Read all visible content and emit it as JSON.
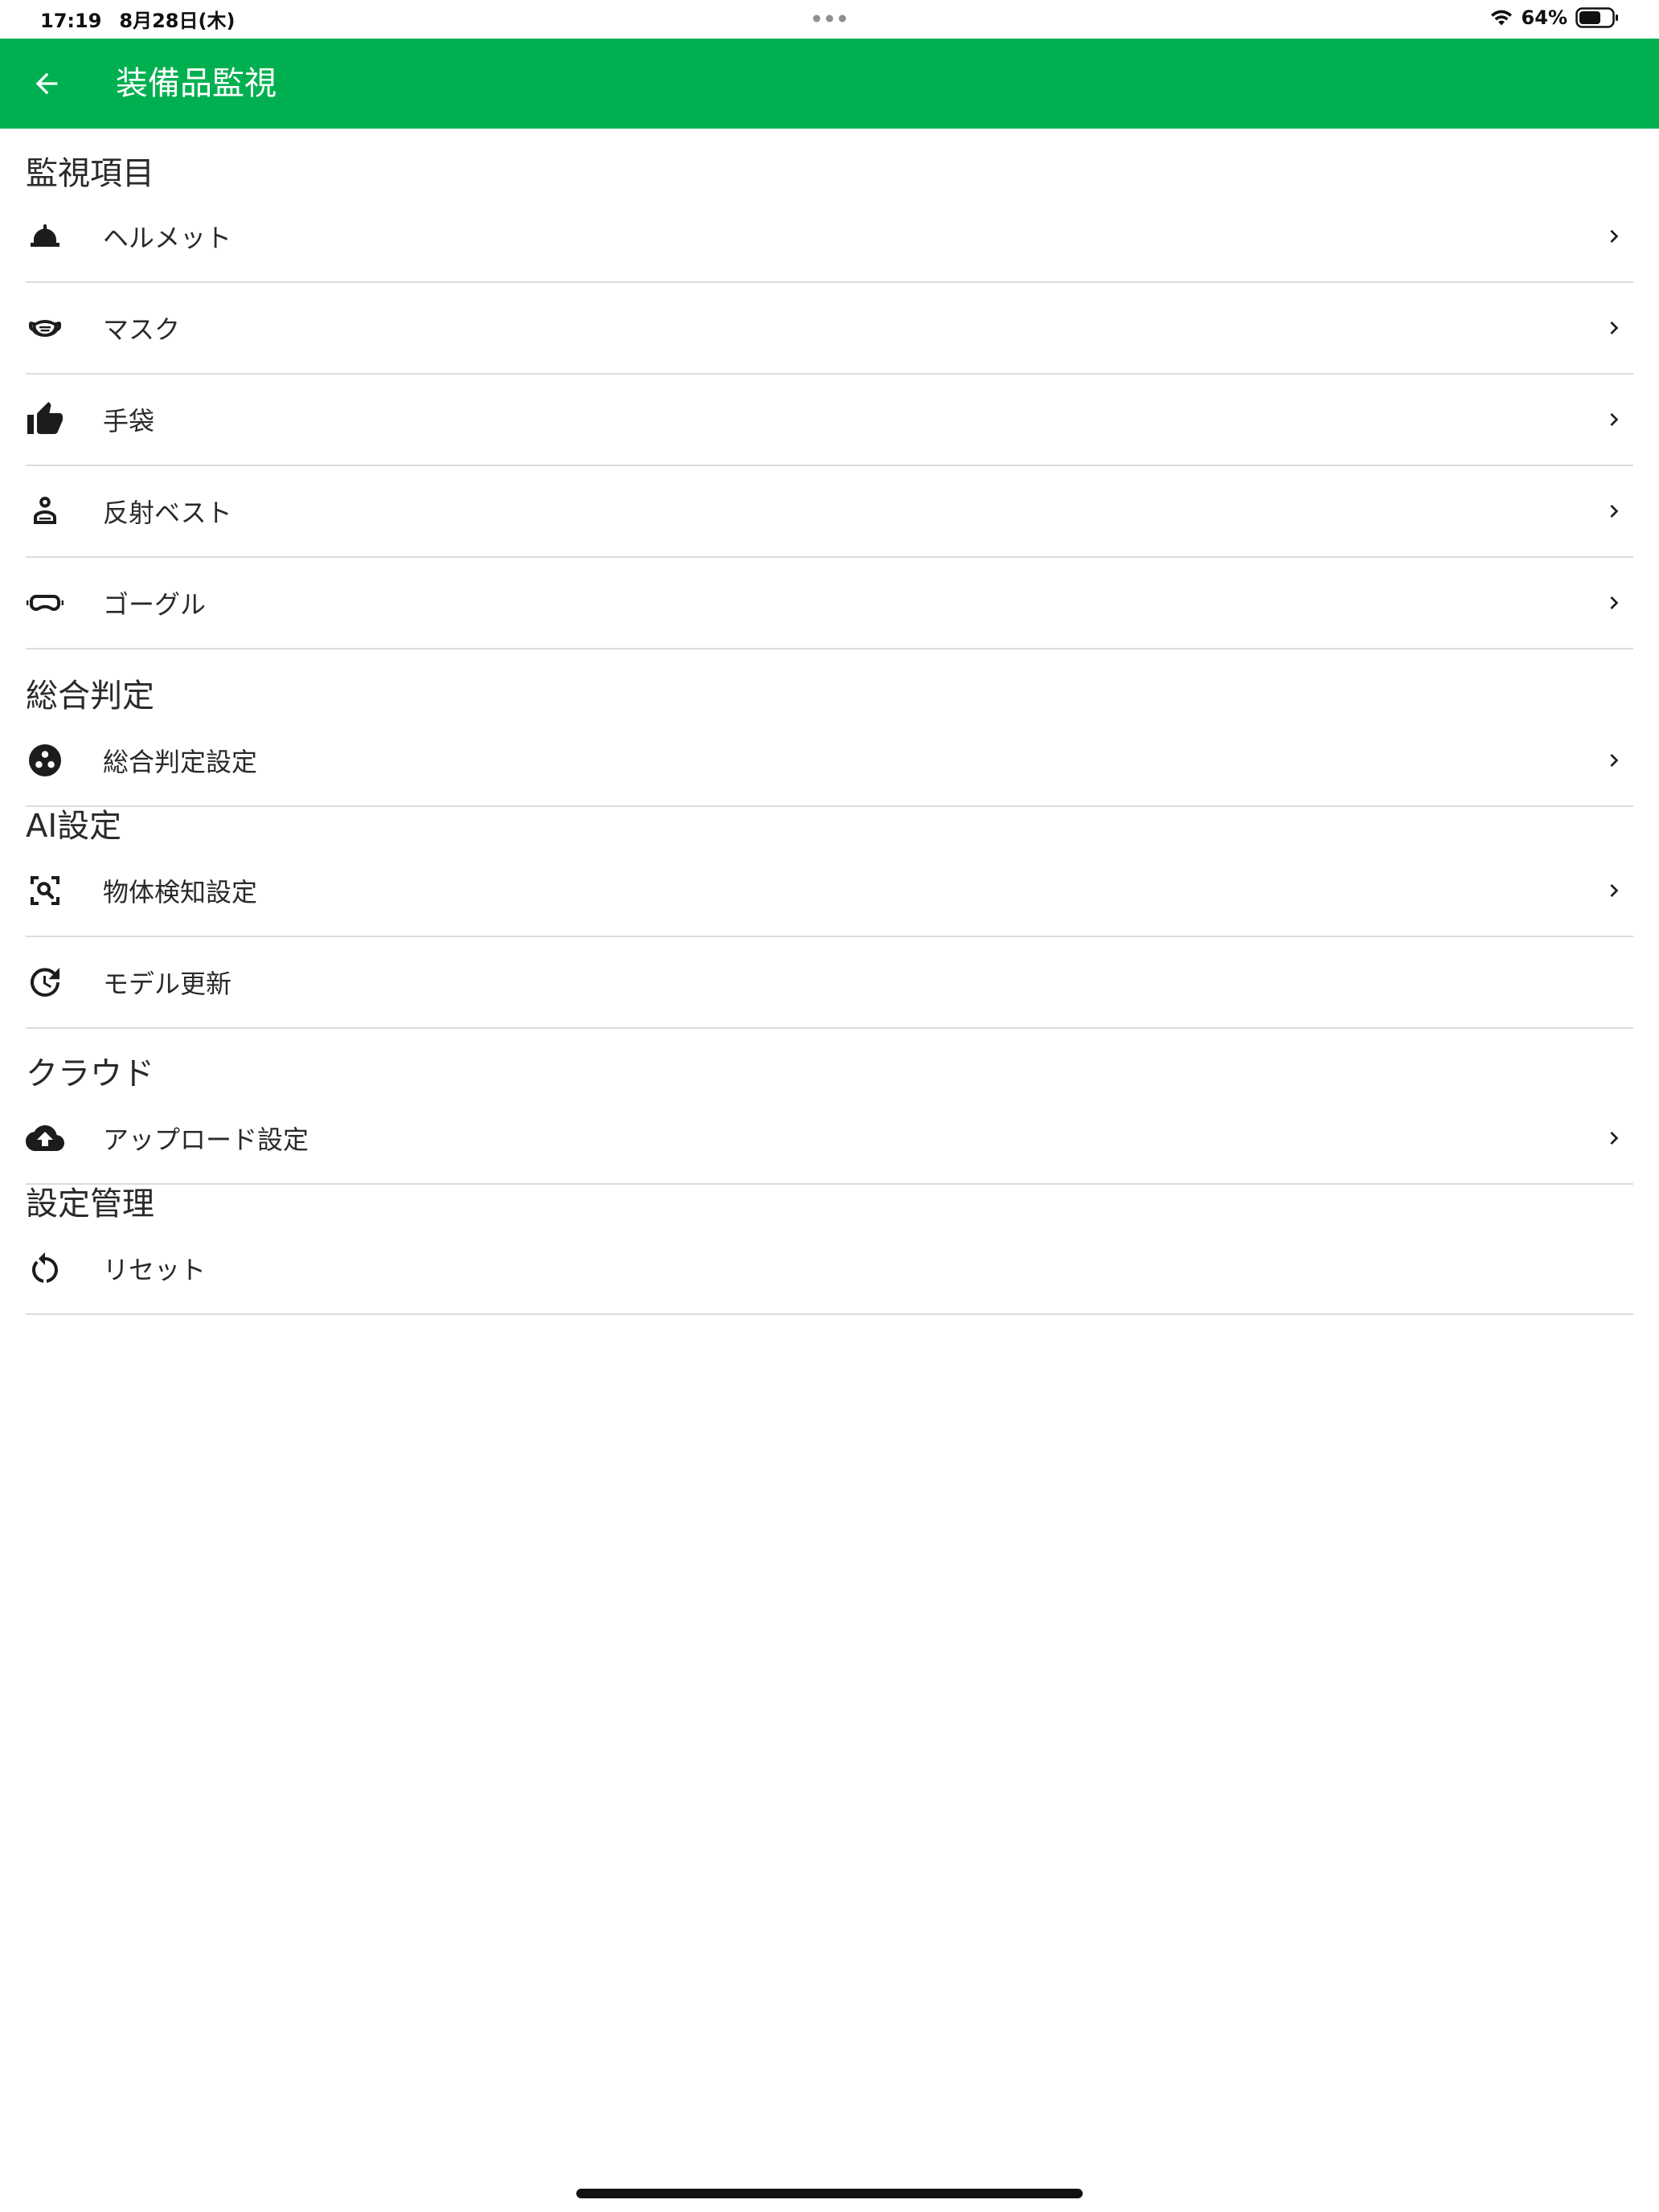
{
  "statusbar": {
    "time": "17:19",
    "date": "8月28日(木)",
    "battery": "64%"
  },
  "appbar": {
    "title": "装備品監視",
    "background": "#00b050"
  },
  "sections": {
    "monitoring": {
      "title": "監視項目",
      "items": [
        {
          "label": "ヘルメット",
          "icon": "helmet-icon"
        },
        {
          "label": "マスク",
          "icon": "mask-icon"
        },
        {
          "label": "手袋",
          "icon": "thumbs-up-icon"
        },
        {
          "label": "反射ベスト",
          "icon": "worker-icon"
        },
        {
          "label": "ゴーグル",
          "icon": "goggles-icon"
        }
      ]
    },
    "judgement": {
      "title": "総合判定",
      "items": [
        {
          "label": "総合判定設定",
          "icon": "workspaces-icon"
        }
      ]
    },
    "ai": {
      "title": "AI設定",
      "items": [
        {
          "label": "物体検知設定",
          "icon": "image-search-icon"
        },
        {
          "label": "モデル更新",
          "icon": "update-icon"
        }
      ]
    },
    "cloud": {
      "title": "クラウド",
      "items": [
        {
          "label": "アップロード設定",
          "icon": "cloud-upload-icon"
        }
      ]
    },
    "management": {
      "title": "設定管理",
      "items": [
        {
          "label": "リセット",
          "icon": "reset-icon"
        }
      ]
    }
  }
}
